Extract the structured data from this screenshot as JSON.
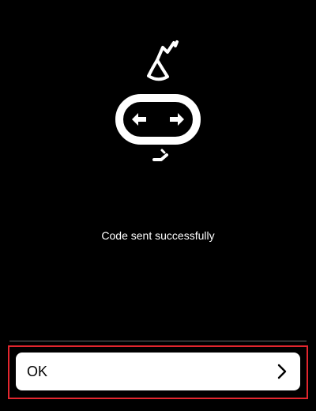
{
  "status": {
    "message": "Code sent successfully"
  },
  "ok_button": {
    "label": "OK",
    "icon": "chevron-right-icon"
  },
  "colors": {
    "background": "#000000",
    "foreground": "#ffffff",
    "highlight": "#e3262e",
    "divider": "#6a6a6a"
  }
}
